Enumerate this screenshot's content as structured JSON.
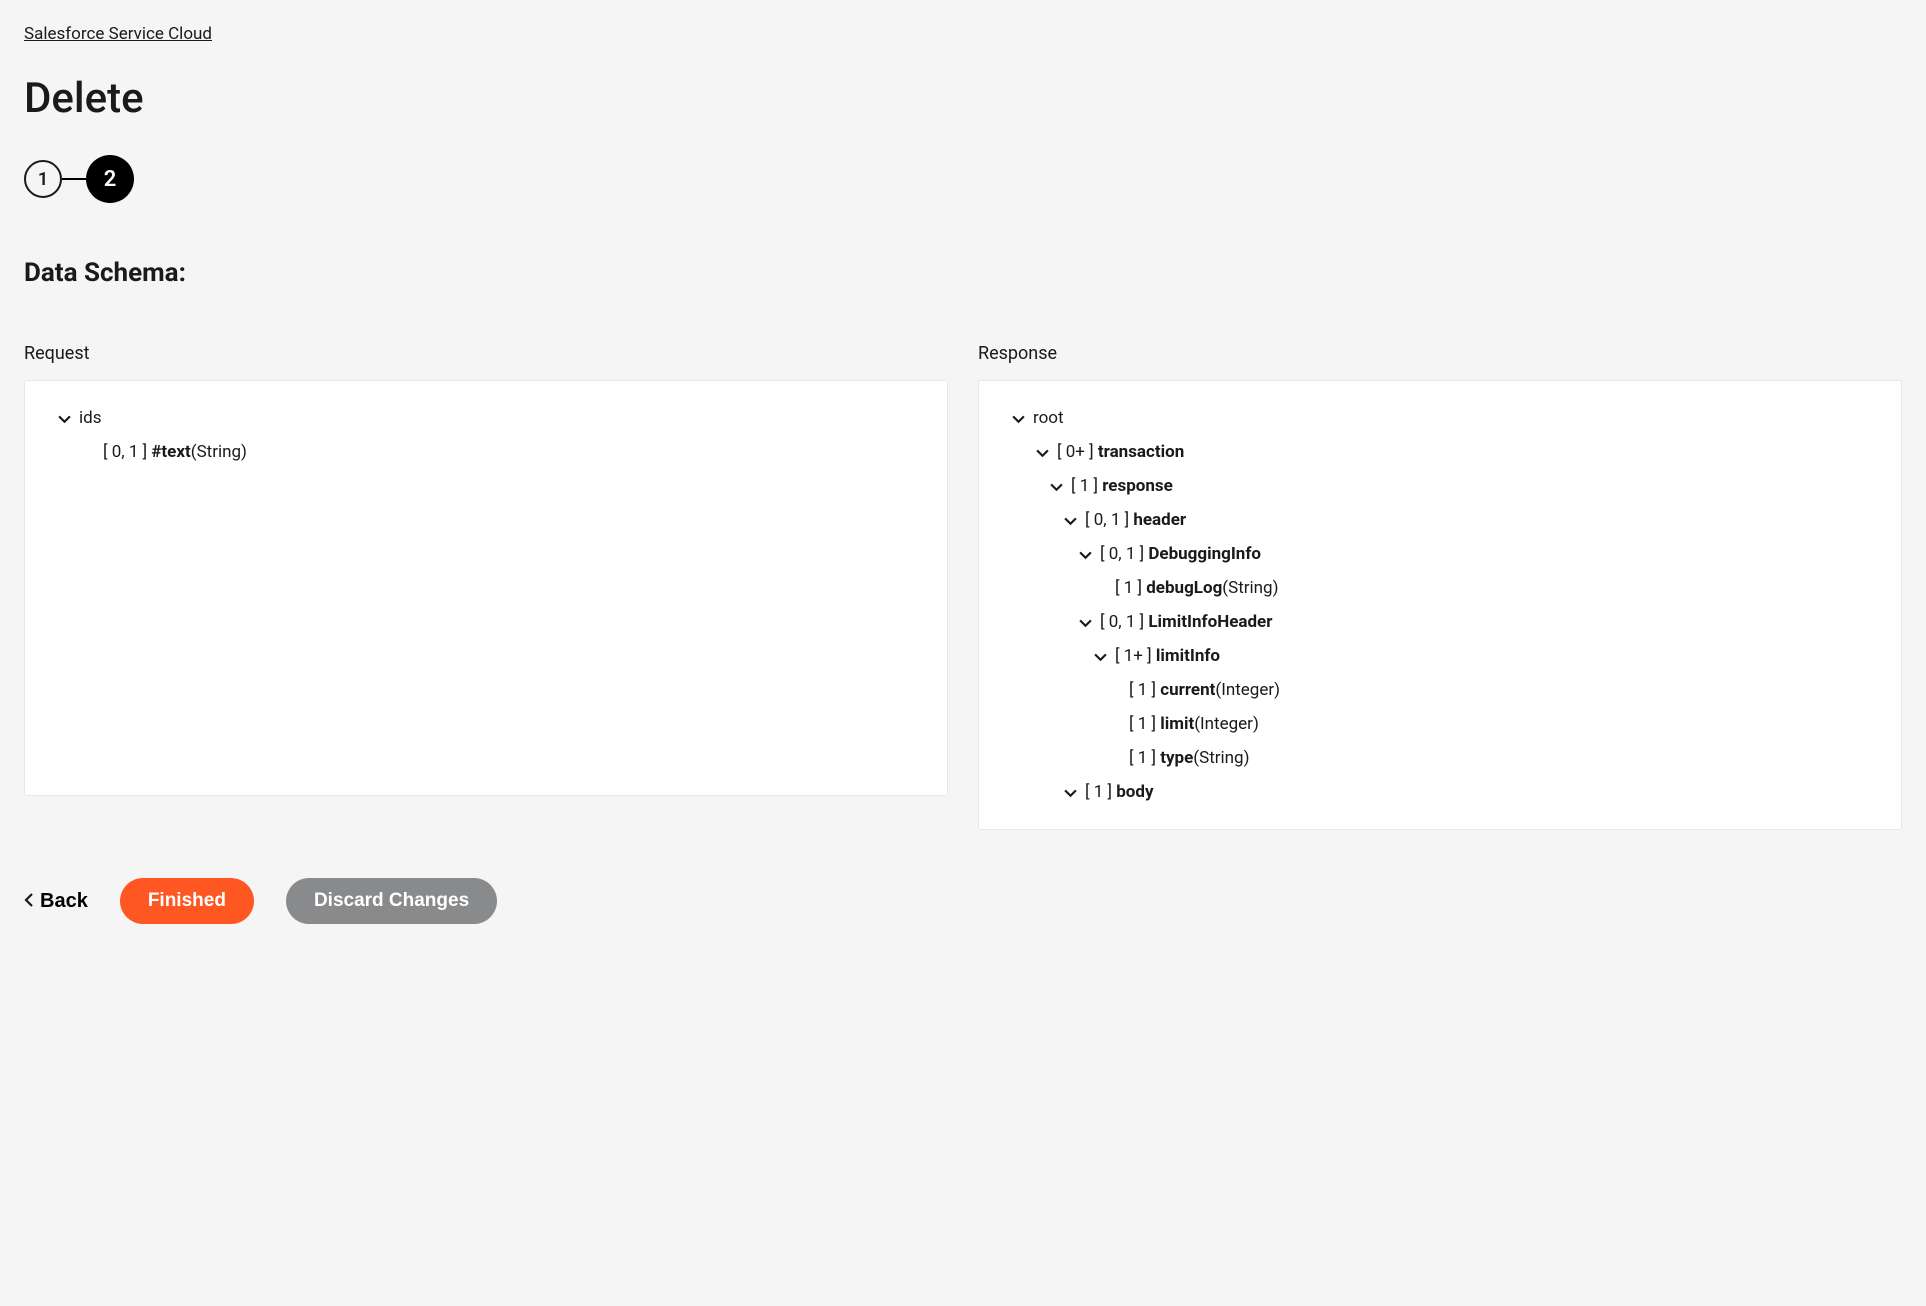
{
  "breadcrumb": "Salesforce Service Cloud",
  "page_title": "Delete",
  "stepper": {
    "step1": "1",
    "step2": "2"
  },
  "section_title": "Data Schema:",
  "request": {
    "label": "Request",
    "tree": {
      "ids": "ids",
      "text_card": "[ 0, 1 ] ",
      "text_name": "#text",
      "text_type": " (String)"
    }
  },
  "response": {
    "label": "Response",
    "tree": {
      "root": "root",
      "transaction_card": "[ 0+ ] ",
      "transaction_name": "transaction",
      "response_card": "[ 1 ] ",
      "response_name": "response",
      "header_card": "[ 0, 1 ] ",
      "header_name": "header",
      "debugginginfo_card": "[ 0, 1 ] ",
      "debugginginfo_name": "DebuggingInfo",
      "debuglog_card": "[ 1 ] ",
      "debuglog_name": "debugLog",
      "debuglog_type": " (String)",
      "limitinfoheader_card": "[ 0, 1 ] ",
      "limitinfoheader_name": "LimitInfoHeader",
      "limitinfo_card": "[ 1+ ] ",
      "limitinfo_name": "limitInfo",
      "current_card": "[ 1 ] ",
      "current_name": "current",
      "current_type": " (Integer)",
      "limit_card": "[ 1 ] ",
      "limit_name": "limit",
      "limit_type": " (Integer)",
      "type_card": "[ 1 ] ",
      "type_name": "type",
      "type_type": " (String)",
      "body_card": "[ 1 ] ",
      "body_name": "body"
    }
  },
  "actions": {
    "back": "Back",
    "finished": "Finished",
    "discard": "Discard Changes"
  }
}
